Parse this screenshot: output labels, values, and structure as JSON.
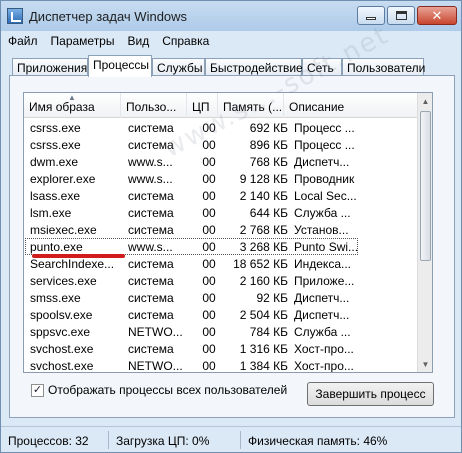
{
  "window": {
    "title": "Диспетчер задач Windows",
    "controls": {
      "minimize": "minimize",
      "maximize": "maximize",
      "close": "close"
    }
  },
  "menu": [
    "Файл",
    "Параметры",
    "Вид",
    "Справка"
  ],
  "tabs": [
    "Приложения",
    "Процессы",
    "Службы",
    "Быстродействие",
    "Сеть",
    "Пользователи"
  ],
  "active_tab": "Процессы",
  "table": {
    "columns": [
      "Имя образа",
      "Пользо...",
      "ЦП",
      "Память (...",
      "Описание"
    ],
    "rows": [
      [
        "csrss.exe",
        "система",
        "00",
        "692 КБ",
        "Процесс ..."
      ],
      [
        "csrss.exe",
        "система",
        "00",
        "896 КБ",
        "Процесс ..."
      ],
      [
        "dwm.exe",
        "www.s...",
        "00",
        "768 КБ",
        "Диспетч..."
      ],
      [
        "explorer.exe",
        "www.s...",
        "00",
        "9 128 КБ",
        "Проводник"
      ],
      [
        "lsass.exe",
        "система",
        "00",
        "2 140 КБ",
        "Local Sec..."
      ],
      [
        "lsm.exe",
        "система",
        "00",
        "644 КБ",
        "Служба ..."
      ],
      [
        "msiexec.exe",
        "система",
        "00",
        "2 768 КБ",
        "Установ..."
      ],
      [
        "punto.exe",
        "www.s...",
        "00",
        "3 268 КБ",
        "Punto Swi..."
      ],
      [
        "SearchIndexe...",
        "система",
        "00",
        "18 652 КБ",
        "Индекса..."
      ],
      [
        "services.exe",
        "система",
        "00",
        "2 160 КБ",
        "Приложе..."
      ],
      [
        "smss.exe",
        "система",
        "00",
        "92 КБ",
        "Диспетч..."
      ],
      [
        "spoolsv.exe",
        "система",
        "00",
        "2 504 КБ",
        "Диспетч..."
      ],
      [
        "sppsvc.exe",
        "NETWO...",
        "00",
        "784 КБ",
        "Служба ..."
      ],
      [
        "svchost.exe",
        "система",
        "00",
        "1 316 КБ",
        "Хост-про..."
      ],
      [
        "svchost.exe",
        "NETWO...",
        "00",
        "1 384 КБ",
        "Хост-про..."
      ]
    ],
    "selected_row": "punto.exe"
  },
  "show_all_checkbox": {
    "label": "Отображать процессы всех пользователей",
    "checked": true,
    "mark": "✓"
  },
  "end_process_button": "Завершить процесс",
  "status": {
    "processes": "Процессов: 32",
    "cpu": "Загрузка ЦП: 0%",
    "memory": "Физическая память: 46%"
  },
  "watermark": "www.s...-soft.net",
  "colors": {
    "window_bg": "#dbe8f5",
    "annotation_underline": "#d21b1b",
    "close_button": "#c8452f"
  }
}
